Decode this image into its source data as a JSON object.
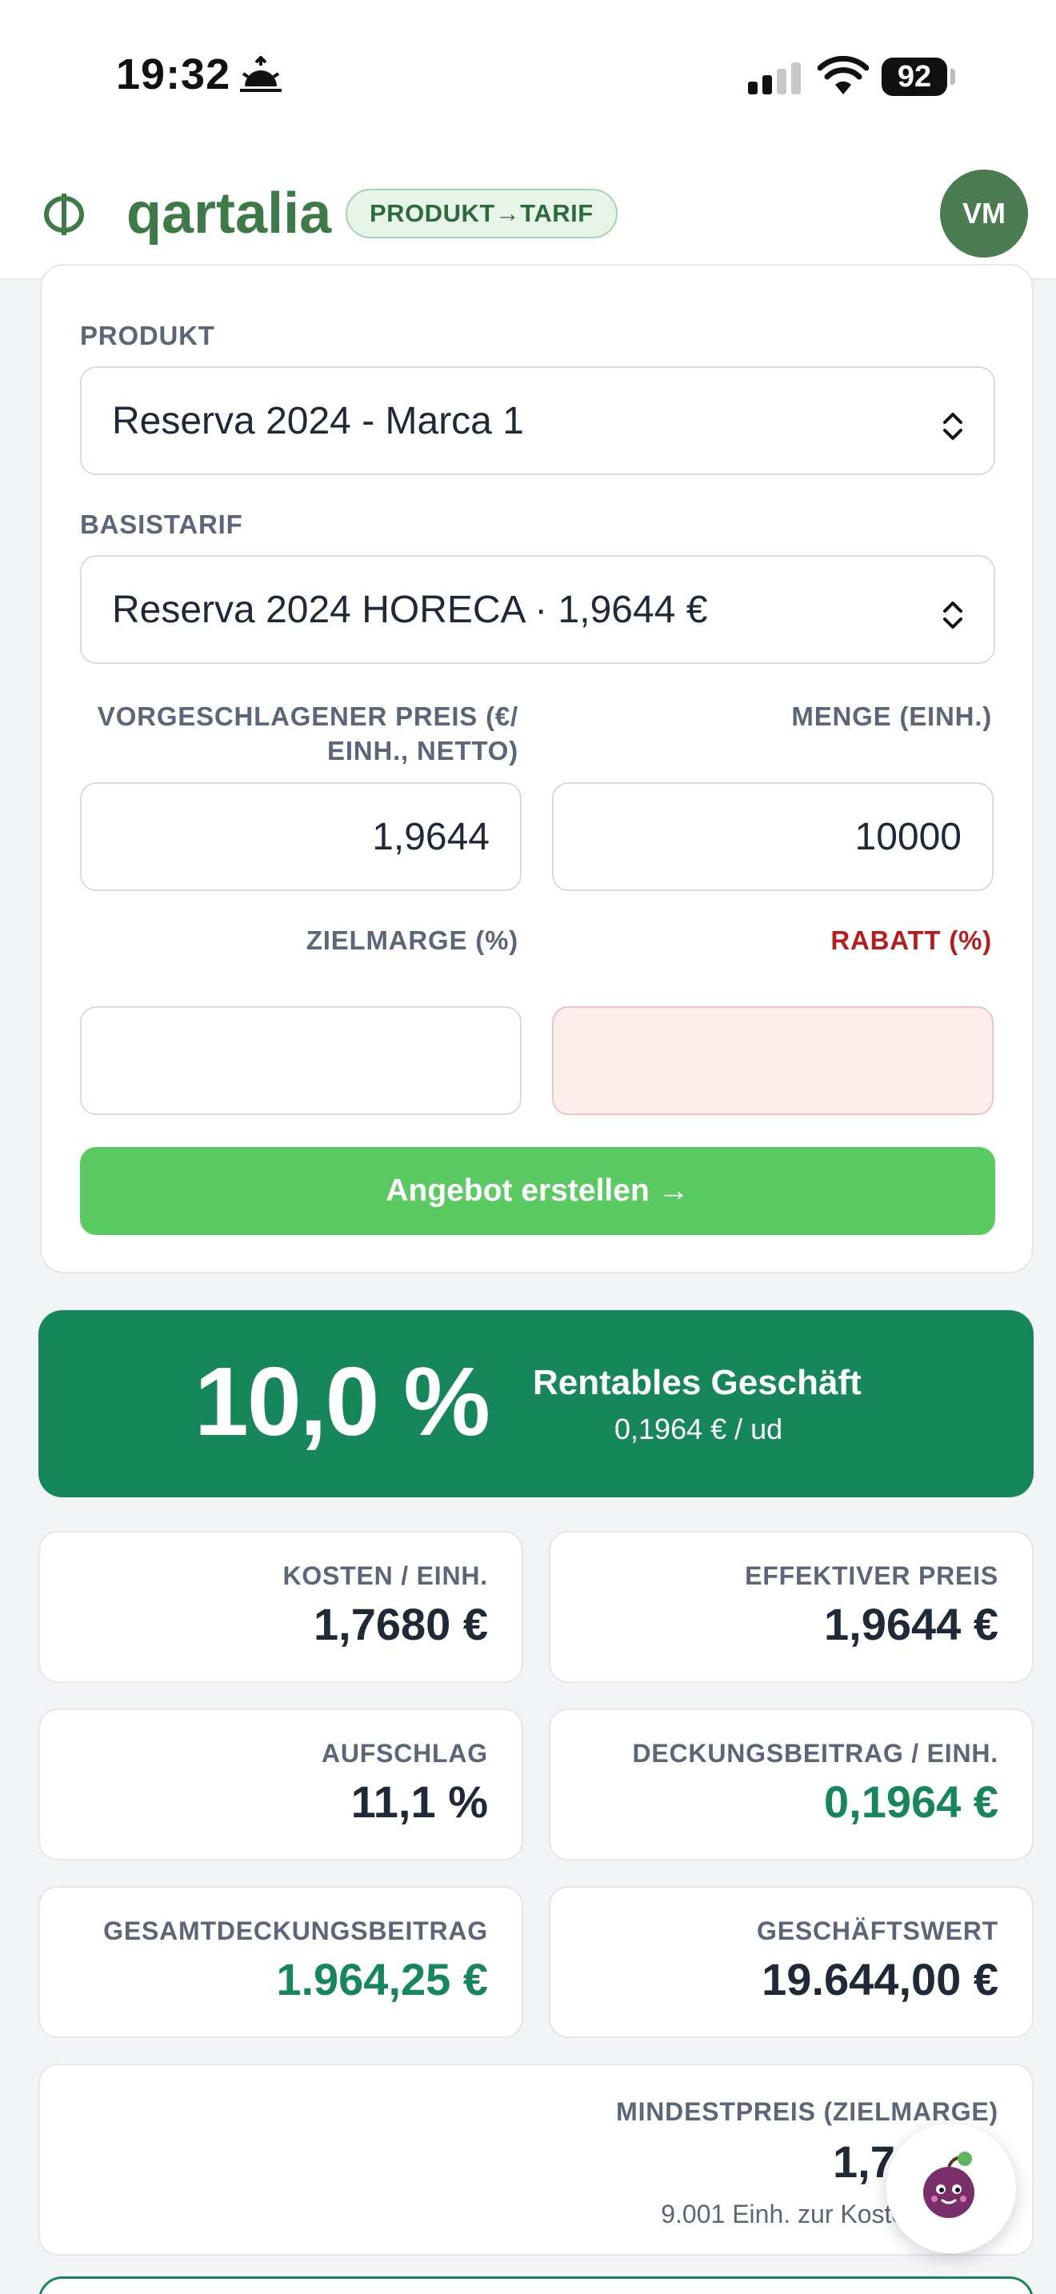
{
  "status_bar": {
    "time": "19:32",
    "battery": "92"
  },
  "header": {
    "brand": "qartalia",
    "mode_badge": "PRODUKT→TARIF",
    "avatar_initials": "VM",
    "icons": [
      "phi-logo-icon"
    ]
  },
  "form": {
    "product_label": "PRODUKT",
    "product_value": "Reserva 2024 - Marca 1",
    "base_tariff_label": "BASISTARIF",
    "base_tariff_value": "Reserva 2024 HORECA · 1,9644 €",
    "suggested_price_label_line1": "VORGESCHLAGENER PREIS (€/",
    "suggested_price_label_line2": "EINH., NETTO)",
    "suggested_price_value": "1,9644",
    "quantity_label": "MENGE (EINH.)",
    "quantity_value": "10000",
    "target_margin_label": "ZIELMARGE (%)",
    "target_margin_value": "",
    "discount_label": "RABATT (%)",
    "discount_value": "",
    "create_button": "Angebot erstellen →"
  },
  "result": {
    "margin_pct": "10,0 %",
    "status": "Rentables Geschäft",
    "per_unit": "0,1964 € / ud"
  },
  "metrics": [
    {
      "label": "KOSTEN / EINH.",
      "value": "1,7680 €"
    },
    {
      "label": "EFFEKTIVER PREIS",
      "value": "1,9644 €"
    },
    {
      "label": "AUFSCHLAG",
      "value": "11,1 %"
    },
    {
      "label": "DECKUNGSBEITRAG / EINH.",
      "value": "0,1964 €"
    },
    {
      "label": "GESAMTDECKUNGSBEITRAG",
      "value": "1.964,25 €"
    },
    {
      "label": "GESCHÄFTSWERT",
      "value": "19.644,00 €"
    }
  ],
  "min_price": {
    "label": "MINDESTPREIS (ZIELMARGE)",
    "value": "1,76",
    "note": "9.001 Einh. zur Kosten"
  },
  "colors": {
    "brand_green": "#3d7a47",
    "profit_green": "#15875a",
    "button_green": "#5cca62",
    "danger_red": "#b91c1c"
  }
}
